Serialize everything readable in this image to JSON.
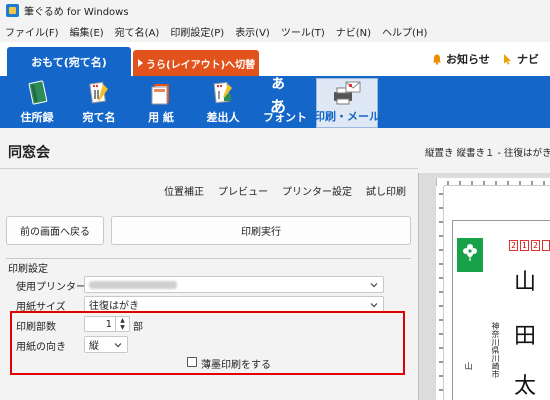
{
  "window": {
    "title": "筆ぐるめ for Windows"
  },
  "menu": [
    "ファイル(F)",
    "編集(E)",
    "宛て名(A)",
    "印刷設定(P)",
    "表示(V)",
    "ツール(T)",
    "ナビ(N)",
    "ヘルプ(H)"
  ],
  "tabs": {
    "front": "おもて(宛て名)",
    "back": "うら(レイアウト)へ切替"
  },
  "header_links": {
    "notice": "お知らせ",
    "navi": "ナビ"
  },
  "toolbar": [
    {
      "label": "住所録",
      "icon": "address-book-icon"
    },
    {
      "label": "宛て名",
      "icon": "address-card-icon"
    },
    {
      "label": "用 紙",
      "icon": "paper-icon"
    },
    {
      "label": "差出人",
      "icon": "sender-icon"
    },
    {
      "label": "フォント",
      "icon": "font-icon",
      "glyph": "ぁあ"
    },
    {
      "label": "印刷・メール",
      "icon": "printer-mail-icon",
      "active": true
    }
  ],
  "page": {
    "title": "同窓会",
    "links": [
      "位置補正",
      "プレビュー",
      "プリンター設定",
      "試し印刷"
    ],
    "back_button": "前の画面へ戻る",
    "execute_button": "印刷実行",
    "group_title": "印刷設定",
    "printer_label": "使用プリンター",
    "printer_value": "Microsoft Print to PDF",
    "paper_size_label": "用紙サイズ",
    "paper_size_value": "往復はがき",
    "copies_label": "印刷部数",
    "copies_value": "1",
    "copies_unit": "部",
    "orientation_label": "用紙の向き",
    "orientation_value": "縦",
    "thin_print_label": "薄墨印刷をする",
    "thin_print_checked": false
  },
  "preview": {
    "header": "縦置き 縦書き１ - 往復はがき",
    "zip_digits": [
      "2",
      "1",
      "2"
    ],
    "name_chars": [
      "山",
      "田",
      "太"
    ],
    "address_vertical": "神奈川県川崎市",
    "sender_char": "山"
  },
  "colors": {
    "brand_blue": "#1466c8",
    "switch_orange": "#e2521c",
    "highlight_red": "#e00000"
  }
}
